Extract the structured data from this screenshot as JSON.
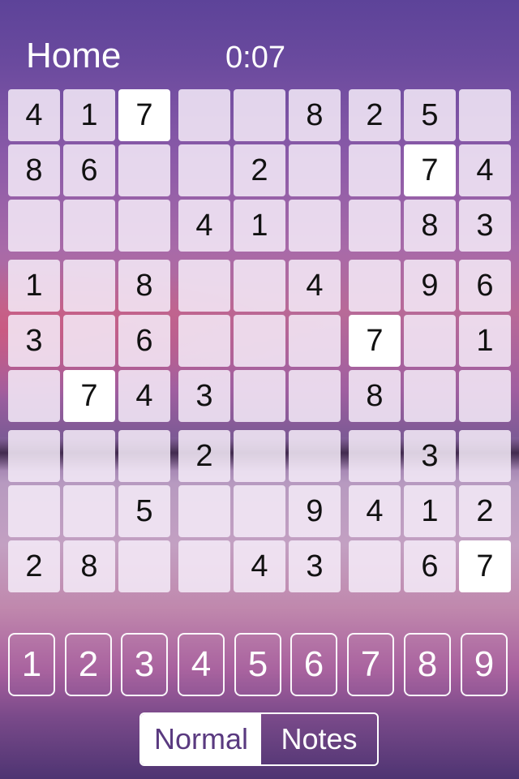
{
  "header": {
    "home_label": "Home",
    "timer": "0:07"
  },
  "board": {
    "rows": [
      [
        "4",
        "1",
        "7",
        "",
        "",
        "8",
        "2",
        "5",
        ""
      ],
      [
        "8",
        "6",
        "",
        "",
        "2",
        "",
        "",
        "7",
        "4"
      ],
      [
        "",
        "",
        "",
        "4",
        "1",
        "",
        "",
        "8",
        "3"
      ],
      [
        "1",
        "",
        "8",
        "",
        "",
        "4",
        "",
        "9",
        "6"
      ],
      [
        "3",
        "",
        "6",
        "",
        "",
        "",
        "7",
        "",
        "1"
      ],
      [
        "",
        "7",
        "4",
        "3",
        "",
        "",
        "8",
        "",
        ""
      ],
      [
        "",
        "",
        "",
        "2",
        "",
        "",
        "",
        "3",
        ""
      ],
      [
        "",
        "",
        "5",
        "",
        "",
        "9",
        "4",
        "1",
        "2"
      ],
      [
        "2",
        "8",
        "",
        "",
        "4",
        "3",
        "",
        "6",
        "7"
      ]
    ],
    "highlighted_cells": [
      [
        0,
        2
      ],
      [
        1,
        7
      ],
      [
        4,
        6
      ],
      [
        5,
        1
      ],
      [
        8,
        8
      ]
    ],
    "highlighted_digit": "7"
  },
  "number_pad": [
    "1",
    "2",
    "3",
    "4",
    "5",
    "6",
    "7",
    "8",
    "9"
  ],
  "mode_toggle": {
    "options": [
      "Normal",
      "Notes"
    ],
    "selected": "Normal"
  },
  "colors": {
    "cell_bg": "#f5ebf8",
    "cell_highlight": "#ffffff",
    "digit_text": "#111111",
    "accent_purple": "#5a3a80"
  }
}
